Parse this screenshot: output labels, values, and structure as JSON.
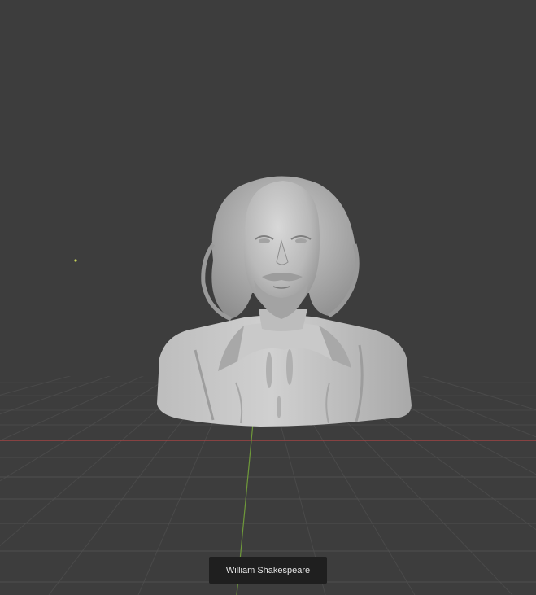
{
  "viewport": {
    "object_name": "William Shakespeare",
    "background_color": "#3d3d3d",
    "grid_color": "#505050",
    "x_axis_color": "#b44545",
    "y_axis_color": "#6f9a3a",
    "label_bg_color": "#1f1f1f",
    "label_text_color": "#e6e6e6",
    "light_icon": "light-marker-icon"
  }
}
